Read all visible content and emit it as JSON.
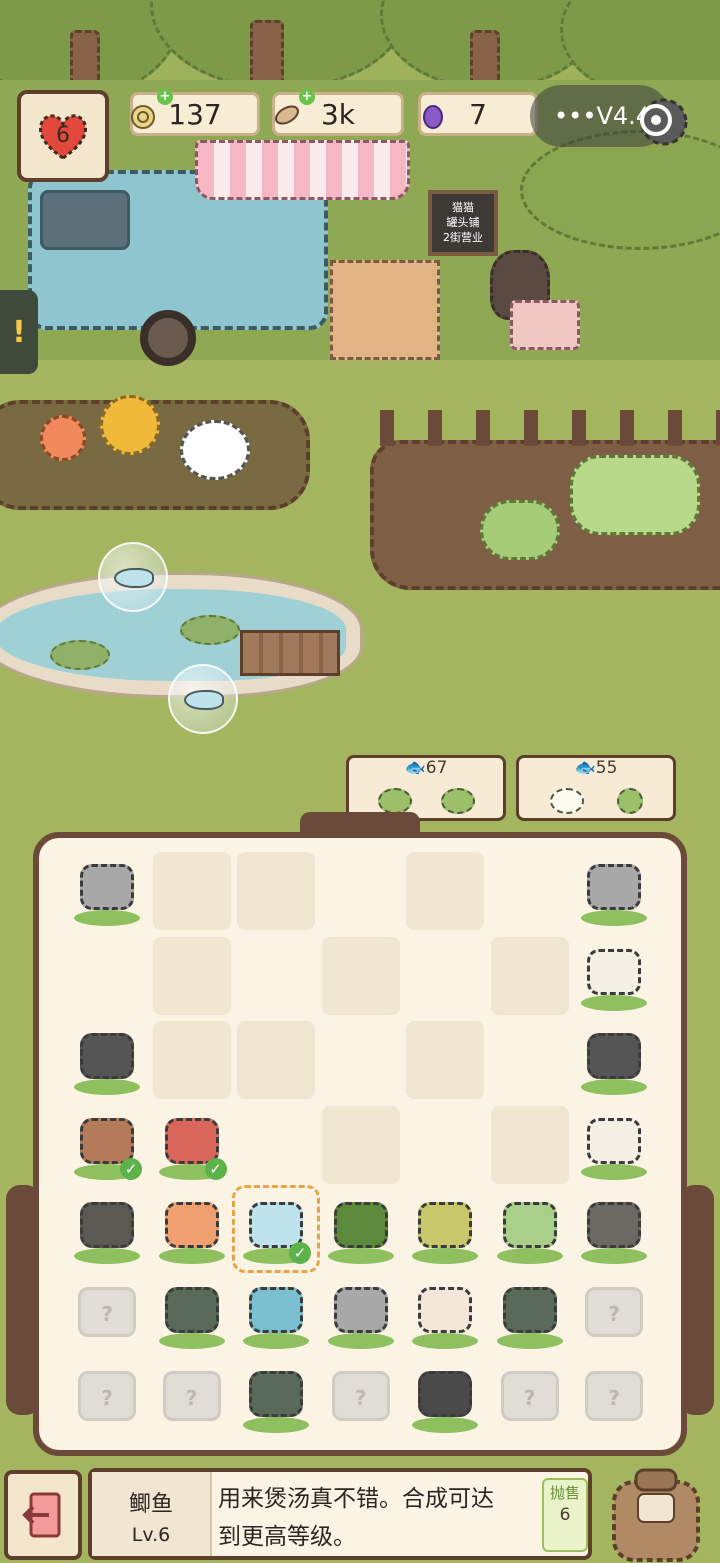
{
  "hud": {
    "hearts": "6",
    "resources": [
      {
        "name": "coin",
        "icon": "coin-icon",
        "value": "137"
      },
      {
        "name": "fish",
        "icon": "fish-currency-icon",
        "value": "3k"
      },
      {
        "name": "gem",
        "icon": "gem-icon",
        "value": "7"
      }
    ],
    "capsule_text": "•••V4.4"
  },
  "scene": {
    "sign_text": "猫猫\n罐头铺\n2街营业"
  },
  "orders": [
    {
      "price": "67",
      "items": [
        "cabbage-icon",
        "cabbage-icon"
      ]
    },
    {
      "price": "55",
      "items": [
        "sheep-icon",
        "sprout-icon"
      ]
    }
  ],
  "board": {
    "rows": [
      [
        "chest",
        "empty",
        "empty",
        "blank",
        "empty",
        "blank",
        "chest"
      ],
      [
        "blank",
        "empty",
        "blank",
        "empty",
        "blank",
        "empty",
        "egg-chick"
      ],
      [
        "rock-bush",
        "empty",
        "empty",
        "blank",
        "empty",
        "blank",
        "rock-bush"
      ],
      [
        "squid",
        "crab",
        "blank",
        "empty",
        "blank",
        "empty",
        "chicken"
      ],
      [
        "seed",
        "koi",
        "crucian-selected",
        "seedling",
        "kelp",
        "lily-pad",
        "stump"
      ],
      [
        "locked",
        "shrub",
        "tuna",
        "chest",
        "cow",
        "shrub",
        "locked"
      ],
      [
        "locked",
        "locked",
        "shrub",
        "locked",
        "pumpkin",
        "locked",
        "locked"
      ]
    ],
    "checked_items": [
      "squid",
      "crab",
      "crucian-selected"
    ]
  },
  "info": {
    "item_name": "鲫鱼",
    "level": "Lv.6",
    "description_line1": "用来煲汤真不错。合成可达",
    "description_line2": "到更高等级。",
    "sell_label": "抛售",
    "sell_price": "6"
  },
  "colors": {
    "board_border": "#6b4a3a",
    "grass": "#a3b55f",
    "accent_orange": "#e6a54a",
    "check_green": "#5db24a"
  }
}
